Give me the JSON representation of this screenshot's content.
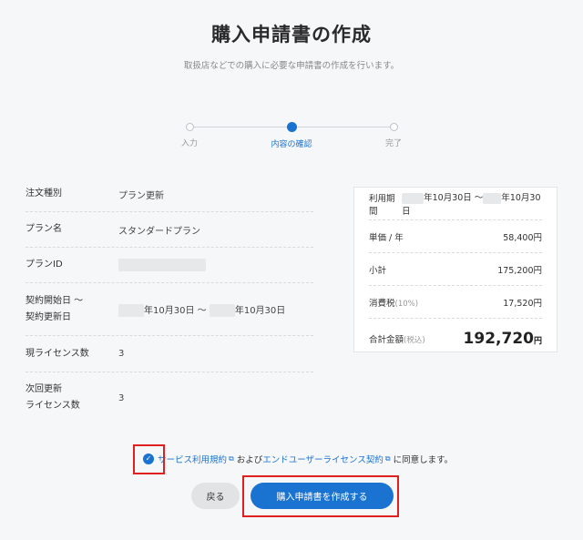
{
  "header": {
    "title": "購入申請書の作成",
    "subtitle": "取扱店などでの購入に必要な申請書の作成を行います。"
  },
  "stepper": {
    "steps": [
      {
        "label": "入力",
        "active": false
      },
      {
        "label": "内容の確認",
        "active": true
      },
      {
        "label": "完了",
        "active": false
      }
    ]
  },
  "details": {
    "order_type_label": "注文種別",
    "order_type_value": "プラン更新",
    "plan_name_label": "プラン名",
    "plan_name_value": "スタンダードプラン",
    "plan_id_label": "プランID",
    "contract_label_1": "契約開始日 〜",
    "contract_label_2": "契約更新日",
    "contract_start_suffix": "年10月30日 〜",
    "contract_end_suffix": "年10月30日",
    "current_license_label": "現ライセンス数",
    "current_license_value": "3",
    "next_license_label_1": "次回更新",
    "next_license_label_2": "ライセンス数",
    "next_license_value": "3"
  },
  "summary": {
    "period_label": "利用期間",
    "period_start_suffix": "年10月30日 〜",
    "period_end_suffix": "年10月30日",
    "unit_price_label": "単価 / 年",
    "unit_price_value": "58,400円",
    "subtotal_label": "小計",
    "subtotal_value": "175,200円",
    "tax_label": "消費税",
    "tax_rate": "(10%)",
    "tax_value": "17,520円",
    "total_label": "合計金額",
    "total_note": "(税込)",
    "total_value": "192,720",
    "total_unit": "円"
  },
  "agreement": {
    "terms_link": "サービス利用規約",
    "and_text": "および",
    "eula_link": "エンドユーザーライセンス契約",
    "agree_text": "に同意します。",
    "checked": true
  },
  "actions": {
    "back_label": "戻る",
    "submit_label": "購入申請書を作成する"
  },
  "colors": {
    "accent": "#1a73d1",
    "highlight": "#e02020"
  }
}
